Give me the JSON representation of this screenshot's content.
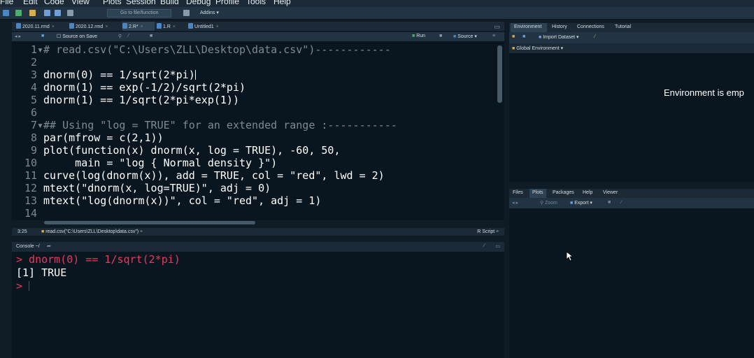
{
  "menubar": [
    "File",
    "Edit",
    "Code",
    "View",
    "Plots",
    "Session",
    "Build",
    "Debug",
    "Profile",
    "Tools",
    "Help"
  ],
  "toolbar": {
    "goto_placeholder": "Go to file/function",
    "addins": "Addins"
  },
  "editor": {
    "tabs": [
      "2020.11.rmd",
      "2020.12.rmd",
      "2.R*",
      "1.R",
      "Untitled1"
    ],
    "source_on_save": "Source on Save",
    "run": "Run",
    "source": "Source",
    "lines": [
      {
        "n": "1",
        "fold": "▾",
        "text": "# read.csv(\"C:\\Users\\ZLL\\Desktop\\data.csv\")------------"
      },
      {
        "n": "2",
        "fold": "",
        "text": ""
      },
      {
        "n": "3",
        "fold": "",
        "text": "dnorm(0) == 1/sqrt(2*pi)"
      },
      {
        "n": "4",
        "fold": "",
        "text": "dnorm(1) == exp(-1/2)/sqrt(2*pi)"
      },
      {
        "n": "5",
        "fold": "",
        "text": "dnorm(1) == 1/sqrt(2*pi*exp(1))"
      },
      {
        "n": "6",
        "fold": "",
        "text": ""
      },
      {
        "n": "7",
        "fold": "▾",
        "text": "## Using \"log = TRUE\" for an extended range :-----------"
      },
      {
        "n": "8",
        "fold": "",
        "text": "par(mfrow = c(2,1))"
      },
      {
        "n": "9",
        "fold": "",
        "text": "plot(function(x) dnorm(x, log = TRUE), -60, 50,"
      },
      {
        "n": "10",
        "fold": "",
        "text": "     main = \"log { Normal density }\")"
      },
      {
        "n": "11",
        "fold": "",
        "text": "curve(log(dnorm(x)), add = TRUE, col = \"red\", lwd = 2)"
      },
      {
        "n": "12",
        "fold": "",
        "text": "mtext(\"dnorm(x, log=TRUE)\", adj = 0)"
      },
      {
        "n": "13",
        "fold": "",
        "text": "mtext(\"log(dnorm(x))\", col = \"red\", adj = 1)"
      },
      {
        "n": "14",
        "fold": "",
        "text": ""
      }
    ]
  },
  "status": {
    "position": "3:25",
    "section": "read.csv(\"C:\\Users\\ZLL\\Desktop\\data.csv\")",
    "filetype": "R Script"
  },
  "console": {
    "title": "Console ~/",
    "lines": [
      "> dnorm(0) == 1/sqrt(2*pi)",
      "[1] TRUE",
      ">"
    ]
  },
  "env": {
    "tabs": [
      "Environment",
      "History",
      "Connections",
      "Tutorial"
    ],
    "import_dataset": "Import Dataset",
    "scope": "Global Environment",
    "empty_message": "Environment is emp"
  },
  "files": {
    "tabs": [
      "Files",
      "Plots",
      "Packages",
      "Help",
      "Viewer"
    ],
    "zoom": "Zoom",
    "export": "Export"
  }
}
